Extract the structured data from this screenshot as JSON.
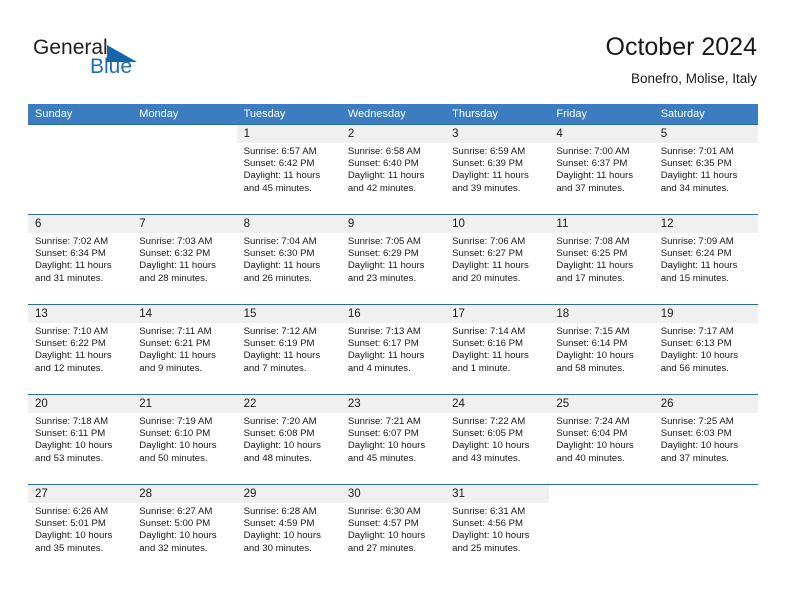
{
  "brand": {
    "name_top": "General",
    "name_bottom": "Blue",
    "accent_color": "#1565a8"
  },
  "header": {
    "title": "October 2024",
    "subtitle": "Bonefro, Molise, Italy"
  },
  "calendar": {
    "header_color": "#3b7dc0",
    "row_border_color": "#2e6da4",
    "daynum_band_color": "#f0f0f0",
    "weekdays": [
      "Sunday",
      "Monday",
      "Tuesday",
      "Wednesday",
      "Thursday",
      "Friday",
      "Saturday"
    ],
    "weeks": [
      [
        {
          "day": "",
          "lines": []
        },
        {
          "day": "",
          "lines": []
        },
        {
          "day": "1",
          "lines": [
            "Sunrise: 6:57 AM",
            "Sunset: 6:42 PM",
            "Daylight: 11 hours",
            "and 45 minutes."
          ]
        },
        {
          "day": "2",
          "lines": [
            "Sunrise: 6:58 AM",
            "Sunset: 6:40 PM",
            "Daylight: 11 hours",
            "and 42 minutes."
          ]
        },
        {
          "day": "3",
          "lines": [
            "Sunrise: 6:59 AM",
            "Sunset: 6:39 PM",
            "Daylight: 11 hours",
            "and 39 minutes."
          ]
        },
        {
          "day": "4",
          "lines": [
            "Sunrise: 7:00 AM",
            "Sunset: 6:37 PM",
            "Daylight: 11 hours",
            "and 37 minutes."
          ]
        },
        {
          "day": "5",
          "lines": [
            "Sunrise: 7:01 AM",
            "Sunset: 6:35 PM",
            "Daylight: 11 hours",
            "and 34 minutes."
          ]
        }
      ],
      [
        {
          "day": "6",
          "lines": [
            "Sunrise: 7:02 AM",
            "Sunset: 6:34 PM",
            "Daylight: 11 hours",
            "and 31 minutes."
          ]
        },
        {
          "day": "7",
          "lines": [
            "Sunrise: 7:03 AM",
            "Sunset: 6:32 PM",
            "Daylight: 11 hours",
            "and 28 minutes."
          ]
        },
        {
          "day": "8",
          "lines": [
            "Sunrise: 7:04 AM",
            "Sunset: 6:30 PM",
            "Daylight: 11 hours",
            "and 26 minutes."
          ]
        },
        {
          "day": "9",
          "lines": [
            "Sunrise: 7:05 AM",
            "Sunset: 6:29 PM",
            "Daylight: 11 hours",
            "and 23 minutes."
          ]
        },
        {
          "day": "10",
          "lines": [
            "Sunrise: 7:06 AM",
            "Sunset: 6:27 PM",
            "Daylight: 11 hours",
            "and 20 minutes."
          ]
        },
        {
          "day": "11",
          "lines": [
            "Sunrise: 7:08 AM",
            "Sunset: 6:25 PM",
            "Daylight: 11 hours",
            "and 17 minutes."
          ]
        },
        {
          "day": "12",
          "lines": [
            "Sunrise: 7:09 AM",
            "Sunset: 6:24 PM",
            "Daylight: 11 hours",
            "and 15 minutes."
          ]
        }
      ],
      [
        {
          "day": "13",
          "lines": [
            "Sunrise: 7:10 AM",
            "Sunset: 6:22 PM",
            "Daylight: 11 hours",
            "and 12 minutes."
          ]
        },
        {
          "day": "14",
          "lines": [
            "Sunrise: 7:11 AM",
            "Sunset: 6:21 PM",
            "Daylight: 11 hours",
            "and 9 minutes."
          ]
        },
        {
          "day": "15",
          "lines": [
            "Sunrise: 7:12 AM",
            "Sunset: 6:19 PM",
            "Daylight: 11 hours",
            "and 7 minutes."
          ]
        },
        {
          "day": "16",
          "lines": [
            "Sunrise: 7:13 AM",
            "Sunset: 6:17 PM",
            "Daylight: 11 hours",
            "and 4 minutes."
          ]
        },
        {
          "day": "17",
          "lines": [
            "Sunrise: 7:14 AM",
            "Sunset: 6:16 PM",
            "Daylight: 11 hours",
            "and 1 minute."
          ]
        },
        {
          "day": "18",
          "lines": [
            "Sunrise: 7:15 AM",
            "Sunset: 6:14 PM",
            "Daylight: 10 hours",
            "and 58 minutes."
          ]
        },
        {
          "day": "19",
          "lines": [
            "Sunrise: 7:17 AM",
            "Sunset: 6:13 PM",
            "Daylight: 10 hours",
            "and 56 minutes."
          ]
        }
      ],
      [
        {
          "day": "20",
          "lines": [
            "Sunrise: 7:18 AM",
            "Sunset: 6:11 PM",
            "Daylight: 10 hours",
            "and 53 minutes."
          ]
        },
        {
          "day": "21",
          "lines": [
            "Sunrise: 7:19 AM",
            "Sunset: 6:10 PM",
            "Daylight: 10 hours",
            "and 50 minutes."
          ]
        },
        {
          "day": "22",
          "lines": [
            "Sunrise: 7:20 AM",
            "Sunset: 6:08 PM",
            "Daylight: 10 hours",
            "and 48 minutes."
          ]
        },
        {
          "day": "23",
          "lines": [
            "Sunrise: 7:21 AM",
            "Sunset: 6:07 PM",
            "Daylight: 10 hours",
            "and 45 minutes."
          ]
        },
        {
          "day": "24",
          "lines": [
            "Sunrise: 7:22 AM",
            "Sunset: 6:05 PM",
            "Daylight: 10 hours",
            "and 43 minutes."
          ]
        },
        {
          "day": "25",
          "lines": [
            "Sunrise: 7:24 AM",
            "Sunset: 6:04 PM",
            "Daylight: 10 hours",
            "and 40 minutes."
          ]
        },
        {
          "day": "26",
          "lines": [
            "Sunrise: 7:25 AM",
            "Sunset: 6:03 PM",
            "Daylight: 10 hours",
            "and 37 minutes."
          ]
        }
      ],
      [
        {
          "day": "27",
          "lines": [
            "Sunrise: 6:26 AM",
            "Sunset: 5:01 PM",
            "Daylight: 10 hours",
            "and 35 minutes."
          ]
        },
        {
          "day": "28",
          "lines": [
            "Sunrise: 6:27 AM",
            "Sunset: 5:00 PM",
            "Daylight: 10 hours",
            "and 32 minutes."
          ]
        },
        {
          "day": "29",
          "lines": [
            "Sunrise: 6:28 AM",
            "Sunset: 4:59 PM",
            "Daylight: 10 hours",
            "and 30 minutes."
          ]
        },
        {
          "day": "30",
          "lines": [
            "Sunrise: 6:30 AM",
            "Sunset: 4:57 PM",
            "Daylight: 10 hours",
            "and 27 minutes."
          ]
        },
        {
          "day": "31",
          "lines": [
            "Sunrise: 6:31 AM",
            "Sunset: 4:56 PM",
            "Daylight: 10 hours",
            "and 25 minutes."
          ]
        },
        {
          "day": "",
          "lines": []
        },
        {
          "day": "",
          "lines": []
        }
      ]
    ]
  }
}
